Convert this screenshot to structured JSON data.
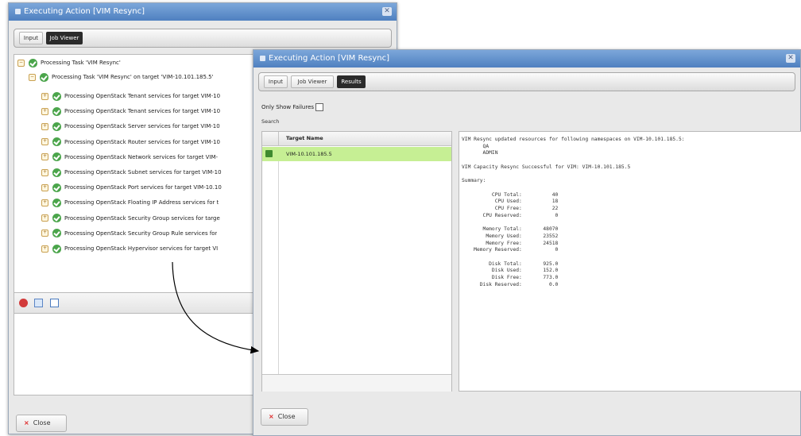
{
  "left_dialog": {
    "title": "Executing Action [VIM Resync]",
    "tabs": [
      "Input",
      "Job Viewer"
    ],
    "tree": {
      "root": "Processing Task 'VIM Resync'",
      "child": "Processing Task 'VIM Resync' on target 'VIM-10.101.185.5'",
      "items": [
        "Processing OpenStack Tenant services for target VIM-10",
        "Processing OpenStack Tenant services for target VIM-10",
        "Processing OpenStack Server services for target VIM-10",
        "Processing OpenStack Router services for target VIM-10",
        "Processing OpenStack Network services for target VIM-",
        "Processing OpenStack Subnet services for target VIM-10",
        "Processing OpenStack Port services for target VIM-10.10",
        "Processing OpenStack Floating IP Address services for t",
        "Processing OpenStack Security Group services for targe",
        "Processing OpenStack Security Group Rule services for",
        "Processing OpenStack Hypervisor services for target VI"
      ]
    },
    "close_label": "Close"
  },
  "right_dialog": {
    "title": "Executing Action [VIM Resync]",
    "tabs": [
      "Input",
      "Job Viewer",
      "Results"
    ],
    "only_show_failures_label": "Only Show Failures",
    "search_label": "Search",
    "table": {
      "column_header": "Target Name",
      "rows": [
        "VIM-10.101.185.5"
      ]
    },
    "results_text": "VIM Resync updated resources for following namespaces on VIM-10.101.185.5:\n       QA\n       ADMIN\n\nVIM Capacity Resync Successful for VIM: VIM-10.101.185.5\n\nSummary:\n\n          CPU Total:          40\n           CPU Used:          18\n           CPU Free:          22\n       CPU Reserved:           0\n\n       Memory Total:       48070\n        Memory Used:       23552\n        Memory Free:       24518\n    Memory Reserved:           0\n\n         Disk Total:       925.0\n          Disk Used:       152.0\n          Disk Free:       773.0\n      Disk Reserved:         0.0",
    "close_label": "Close"
  },
  "colors": {
    "titlebar": "#5b8bc8",
    "selected_row": "#c6ef94",
    "success_check": "#4ba54b"
  }
}
